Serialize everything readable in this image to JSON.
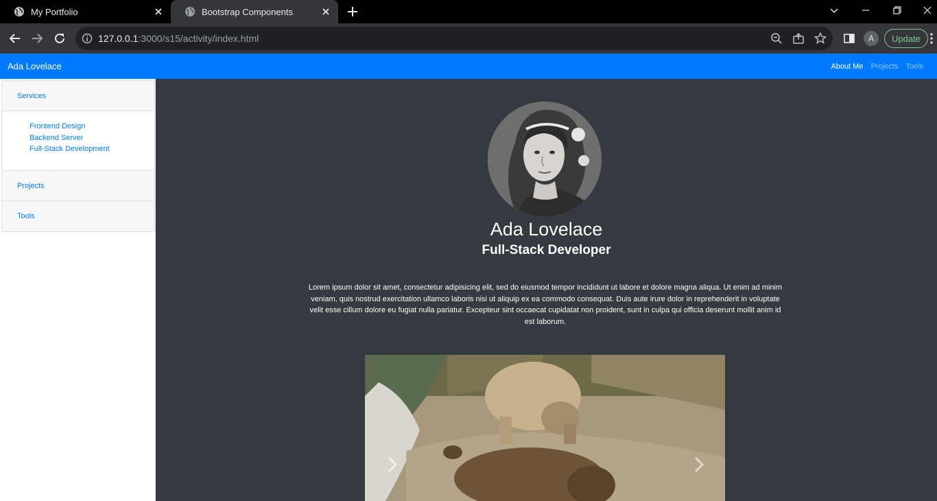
{
  "browser": {
    "tabs": [
      {
        "title": "My Portfolio",
        "active": false
      },
      {
        "title": "Bootstrap Components",
        "active": true
      }
    ],
    "url_host": "127.0.0.1",
    "url_rest": ":3000/s15/activity/index.html",
    "profile_initial": "A",
    "update_label": "Update"
  },
  "navbar": {
    "brand": "Ada Lovelace",
    "links": [
      {
        "label": "About Me",
        "active": true
      },
      {
        "label": "Projects",
        "active": false
      },
      {
        "label": "Tools",
        "active": false
      }
    ],
    "color": "#007bff"
  },
  "sidebar": {
    "sections": [
      {
        "title": "Services",
        "items": [
          "Frontend Design",
          "Backend Server",
          "Full-Stack Development"
        ]
      },
      {
        "title": "Projects"
      },
      {
        "title": "Tools"
      }
    ]
  },
  "profile": {
    "name": "Ada Lovelace",
    "role": "Full-Stack Developer",
    "bio": "Lorem ipsum dolor sit amet, consectetur adipisicing elit, sed do eiusmod tempor incididunt ut labore et dolore magna aliqua. Ut enim ad minim veniam, quis nostrud exercitation ullamco laboris nisi ut aliquip ex ea commodo consequat. Duis aute irure dolor in reprehenderit in voluptate velit esse cillum dolore eu fugiat nulla pariatur. Excepteur sint occaecat cupidatat non proident, sunt in culpa qui officia deserunt mollit anim id est laborum."
  },
  "icons": {
    "tab_favicon": "globe-icon",
    "back": "arrow-left-icon",
    "forward": "arrow-right-icon",
    "reload": "reload-icon",
    "zoom": "zoom-out-icon",
    "share": "share-icon",
    "bookmark": "star-icon",
    "side_panel": "side-panel-icon",
    "carousel_prev": "chevron-left-icon",
    "carousel_next": "chevron-right-icon"
  }
}
